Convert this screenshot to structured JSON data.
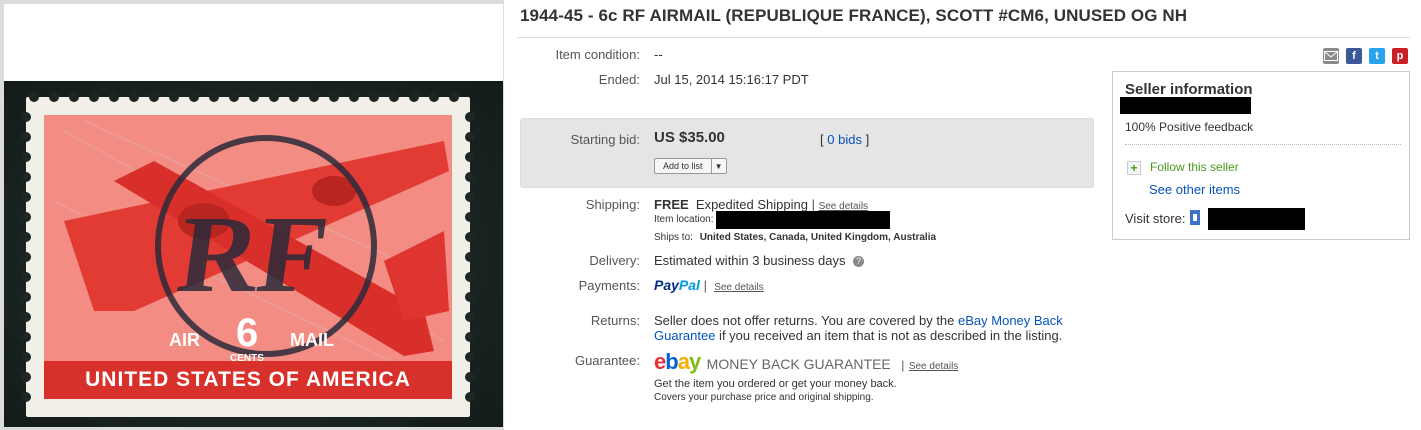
{
  "listing": {
    "title": "1944-45 - 6c RF AIRMAIL (REPUBLIQUE FRANCE), SCOTT #CM6, UNUSED OG NH"
  },
  "stamp_image": {
    "top_text_left": "AIR",
    "denomination": "6",
    "top_text_right": "MAIL",
    "cents": "CENTS",
    "country": "UNITED STATES OF AMERICA",
    "overprint": "RF"
  },
  "details": {
    "condition_label": "Item condition:",
    "condition_value": "--",
    "ended_label": "Ended:",
    "ended_value": "Jul 15, 2014  15:16:17 PDT",
    "bid_label": "Starting bid:",
    "bid_value": "US $35.00",
    "bids_open": "[",
    "bids_link": "0 bids",
    "bids_close": "]",
    "add_to_list": "Add to list",
    "shipping_label": "Shipping:",
    "shipping_free": "FREE",
    "shipping_method": "Expedited Shipping",
    "shipping_sep": "|",
    "shipping_details": "See details",
    "item_location_label": "Item location:",
    "ships_to_label": "Ships to:",
    "ships_to_value": "United States, Canada, United Kingdom, Australia",
    "delivery_label": "Delivery:",
    "delivery_value": "Estimated within 3 business days",
    "payments_label": "Payments:",
    "paypal_a": "Pay",
    "paypal_b": "Pal",
    "payments_sep": "|",
    "payments_details": "See details",
    "returns_label": "Returns:",
    "returns_text_1": "Seller does not offer returns. You are covered by the ",
    "returns_link_1": "eBay Money Back",
    "returns_link_2": "Guarantee",
    "returns_text_2": " if you received an item that is not as described in the listing.",
    "guarantee_label": "Guarantee:",
    "guarantee_mbg": "MONEY BACK GUARANTEE",
    "guarantee_sep": "|",
    "guarantee_details": "See details",
    "guarantee_line1": "Get the item you ordered or get your money back.",
    "guarantee_line2": "Covers your purchase price and original shipping."
  },
  "seller": {
    "heading": "Seller information",
    "feedback": "100% Positive feedback",
    "follow": "Follow this seller",
    "other_items": "See other items",
    "visit_store": "Visit store:"
  },
  "colors": {
    "link": "#0654ba",
    "follow_green": "#4a9a1e",
    "stamp_red": "#e03a36",
    "ebay_e": "#e53238",
    "ebay_b": "#0064d2",
    "ebay_a": "#f5af02",
    "ebay_y": "#86b817"
  },
  "icons": [
    "email-share-icon",
    "facebook-icon",
    "twitter-icon",
    "pinterest-icon",
    "help-icon",
    "plus-icon",
    "store-icon",
    "dropdown-arrow-icon"
  ]
}
